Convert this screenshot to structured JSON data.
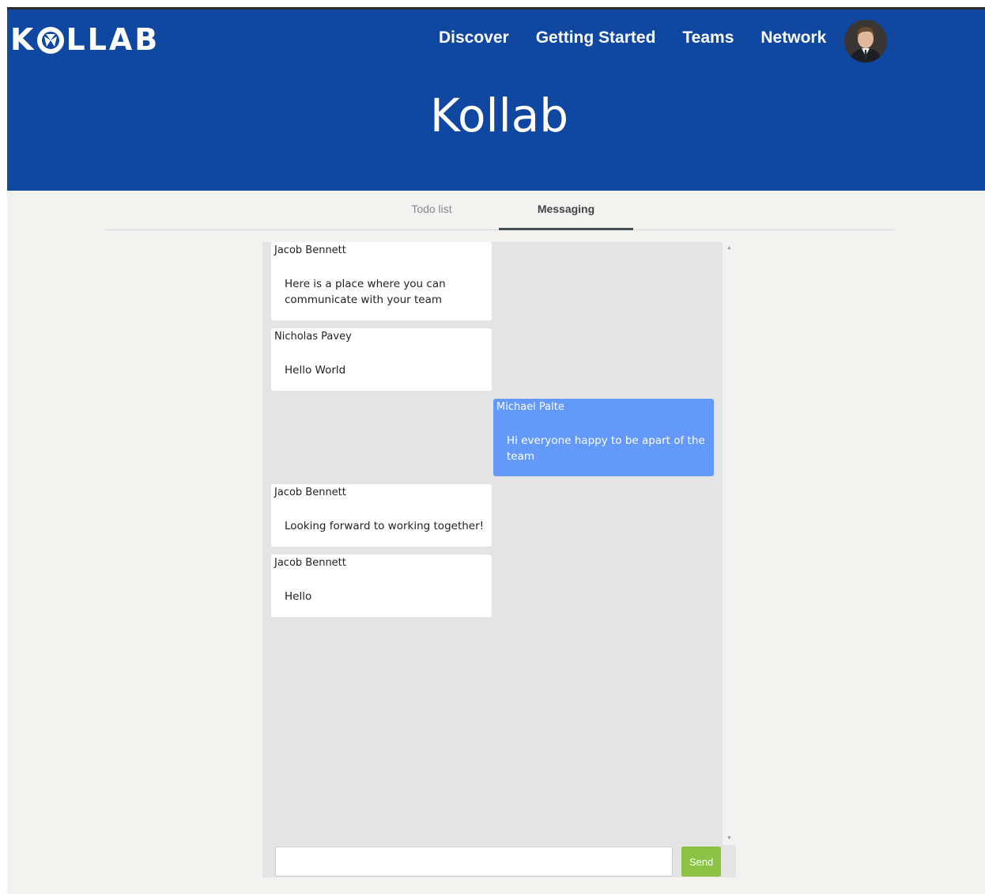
{
  "brand": {
    "logo_text_left": "K",
    "logo_text_right": "LLAB",
    "title": "Kollab"
  },
  "nav": {
    "items": [
      {
        "label": "Discover"
      },
      {
        "label": "Getting Started"
      },
      {
        "label": "Teams"
      },
      {
        "label": "Network"
      }
    ]
  },
  "colors": {
    "header": "#0f47a1",
    "own_message": "#6399f9",
    "send_button": "#8dc345"
  },
  "tabs": [
    {
      "label": "Todo list",
      "active": false
    },
    {
      "label": "Messaging",
      "active": true
    }
  ],
  "messages": [
    {
      "sender": "Jacob Bennett",
      "text": "Here is a place where you can communicate with your team",
      "own": false
    },
    {
      "sender": "Nicholas Pavey",
      "text": "Hello World",
      "own": false
    },
    {
      "sender": "Michael Palte",
      "text": "Hi everyone happy to be apart of the team",
      "own": true
    },
    {
      "sender": "Jacob Bennett",
      "text": "Looking forward to working together!",
      "own": false
    },
    {
      "sender": "Jacob Bennett",
      "text": "Hello",
      "own": false
    }
  ],
  "composer": {
    "value": "",
    "placeholder": "",
    "send_label": "Send"
  }
}
